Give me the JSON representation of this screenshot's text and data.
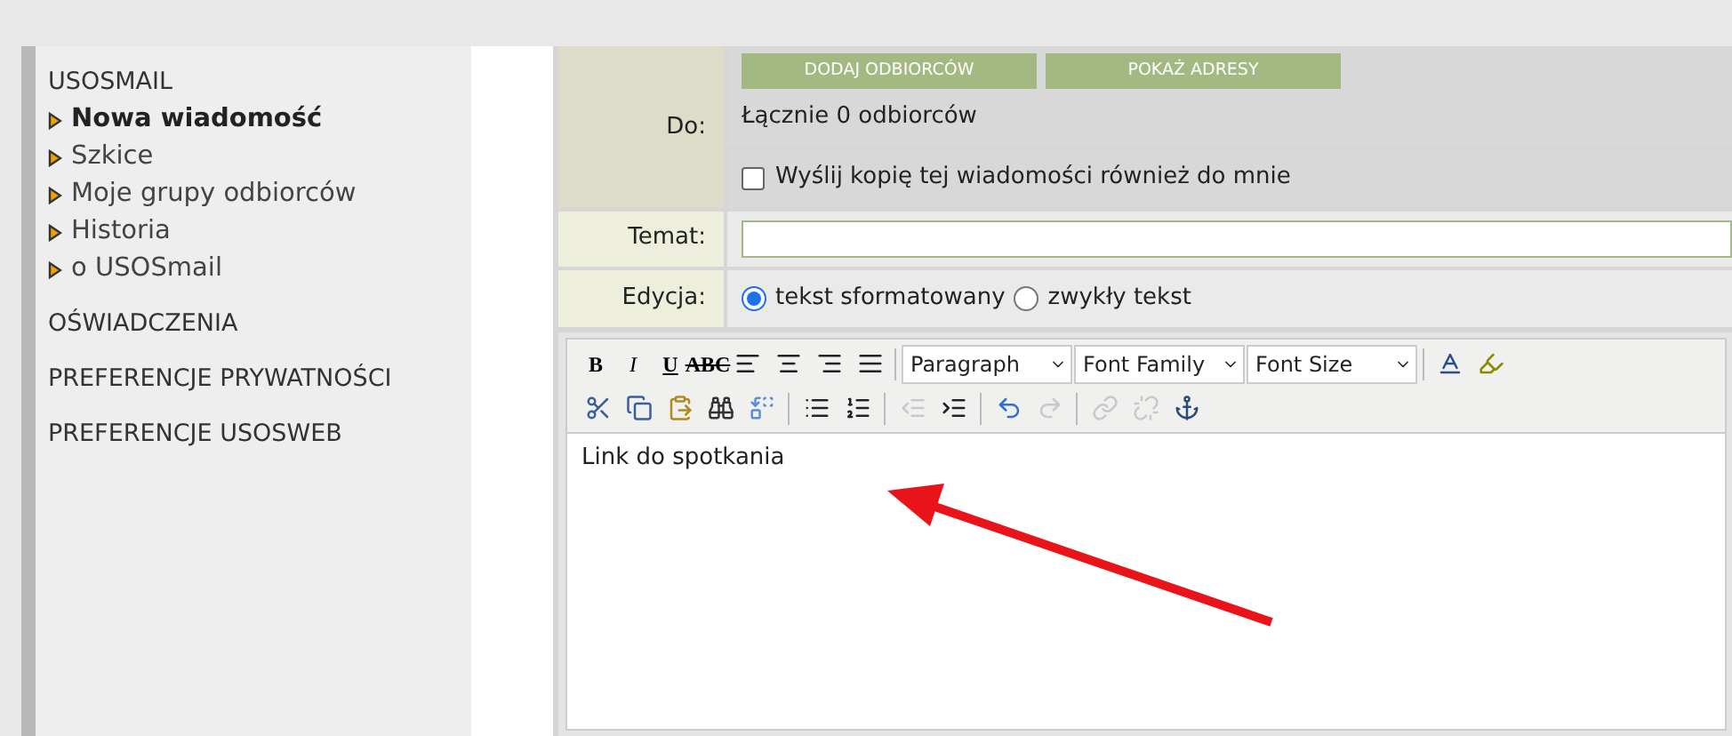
{
  "sidebar": {
    "sections": [
      {
        "title": "USOSMAIL",
        "items": [
          {
            "label": "Nowa wiadomość",
            "selected": true
          },
          {
            "label": "Szkice",
            "selected": false
          },
          {
            "label": "Moje grupy odbiorców",
            "selected": false
          },
          {
            "label": "Historia",
            "selected": false
          },
          {
            "label": "o USOSmail",
            "selected": false
          }
        ]
      },
      {
        "title": "OŚWIADCZENIA"
      },
      {
        "title": "PREFERENCJE PRYWATNOŚCI"
      },
      {
        "title": "PREFERENCJE USOSWEB"
      }
    ]
  },
  "form": {
    "to_label": "Do:",
    "buttons": [
      "DODAJ ODBIORCÓW",
      "POKAŻ ADRESY"
    ],
    "recipients": "Łącznie 0 odbiorców",
    "copy_to_me": {
      "label": "Wyślij kopię tej wiadomości również do mnie",
      "checked": false
    },
    "subject_label": "Temat:",
    "edit_label": "Edycja:",
    "edit_modes": [
      {
        "label": "tekst sformatowany",
        "selected": true
      },
      {
        "label": "zwykły tekst",
        "selected": false
      }
    ]
  },
  "editor": {
    "toolbar_row_1": [
      {
        "kind": "text",
        "text": "B"
      },
      {
        "kind": "text",
        "text": "I"
      },
      {
        "kind": "text",
        "text": "U"
      },
      {
        "kind": "text",
        "text": "ABC"
      },
      {
        "kind": "icon"
      },
      {
        "kind": "icon"
      },
      {
        "kind": "icon"
      },
      {
        "kind": "icon"
      },
      {
        "kind": "select",
        "text": "Paragraph"
      },
      {
        "kind": "select",
        "text": "Font Family"
      },
      {
        "kind": "select",
        "text": "Font Size"
      },
      {
        "kind": "icon"
      },
      {
        "kind": "icon"
      }
    ],
    "toolbar_row_2": [
      {
        "disabled": false
      },
      {
        "disabled": false
      },
      {
        "disabled": false
      },
      {
        "disabled": false
      },
      {
        "disabled": false
      },
      {
        "disabled": false
      },
      {
        "disabled": false
      },
      {
        "disabled": true
      },
      {
        "disabled": false
      },
      {
        "disabled": false
      },
      {
        "disabled": true
      },
      {
        "disabled": true
      },
      {
        "disabled": true
      },
      {
        "disabled": false
      }
    ],
    "content": "Link do spotkania"
  }
}
